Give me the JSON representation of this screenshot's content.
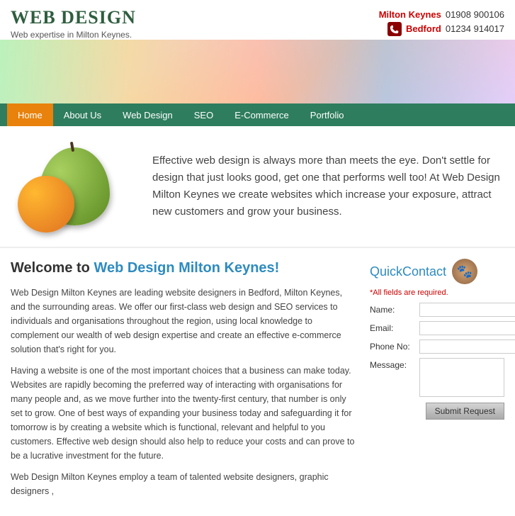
{
  "header": {
    "logo_title": "Web Design",
    "logo_subtitle": "Web expertise in Milton Keynes.",
    "contact1_location": "Milton Keynes",
    "contact1_phone": "01908 900106",
    "contact2_location": "Bedford",
    "contact2_phone": "01234 914017"
  },
  "nav": {
    "items": [
      {
        "label": "Home",
        "active": true
      },
      {
        "label": "About Us",
        "active": false
      },
      {
        "label": "Web Design",
        "active": false
      },
      {
        "label": "SEO",
        "active": false
      },
      {
        "label": "E-Commerce",
        "active": false
      },
      {
        "label": "Portfolio",
        "active": false
      }
    ]
  },
  "hero": {
    "text": "Effective web design is always more than meets the eye. Don't settle for design that just looks good, get one that performs well too! At Web Design Milton Keynes we create websites which increase your exposure, attract new customers and grow your business."
  },
  "main": {
    "welcome_heading_plain": "Welcome to ",
    "welcome_heading_highlight": "Web Design Milton Keynes!",
    "paragraph1": "Web Design Milton Keynes are leading website designers in Bedford, Milton Keynes, and the surrounding areas. We offer our first-class web design and SEO services to individuals and organisations throughout the region, using local knowledge to complement our wealth of web design expertise and create an effective e-commerce solution that's right for you.",
    "paragraph2": "Having a website is one of the most important choices that a business can make today. Websites are rapidly becoming the preferred way of interacting with organisations for many people and, as we move further into the twenty-first century, that number is only set to grow. One of best ways of expanding your business today and safeguarding it for tomorrow is by creating a website which is functional, relevant and helpful to you customers. Effective web design should also help to reduce your costs and can prove to be a lucrative investment for the future.",
    "paragraph3": "Web Design Milton Keynes employ a team of talented website designers, graphic designers ,"
  },
  "sidebar": {
    "quick_contact_label": "Quick",
    "quick_contact_label2": "Contact",
    "required_note": "*All fields are required.",
    "field_name": "Name:",
    "field_email": "Email:",
    "field_phone": "Phone No:",
    "field_message": "Message:",
    "submit_label": "Submit Request"
  }
}
